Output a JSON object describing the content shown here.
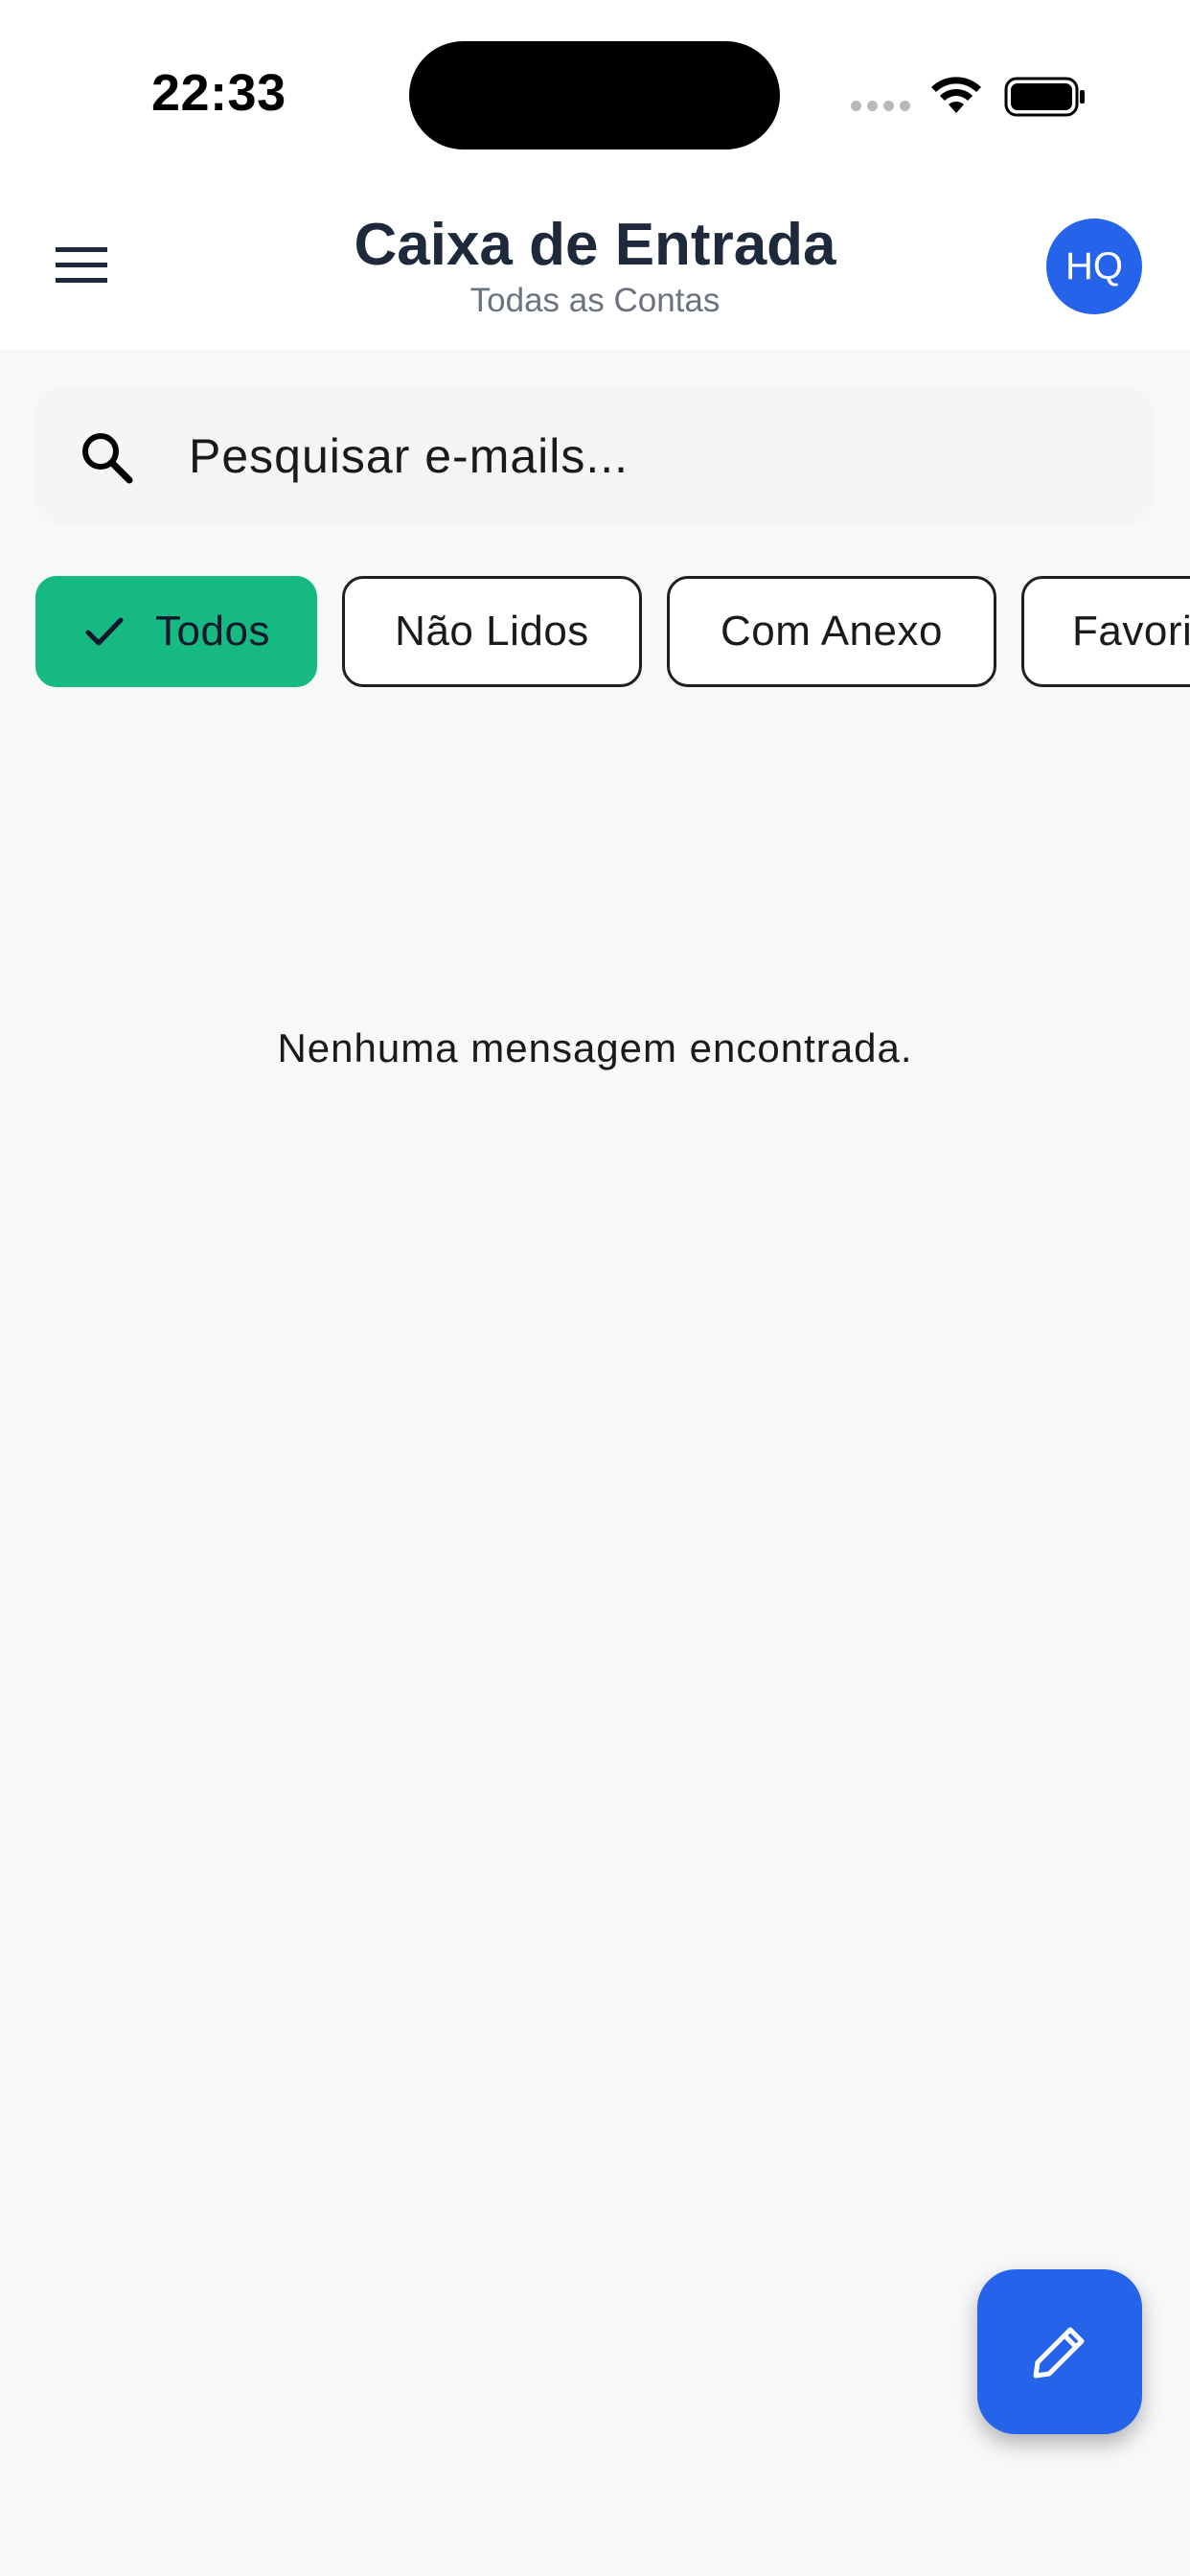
{
  "status_bar": {
    "time": "22:33",
    "icons": [
      "signal-dots-icon",
      "wifi-icon",
      "battery-icon"
    ]
  },
  "header": {
    "title": "Caixa de Entrada",
    "subtitle": "Todas as Contas",
    "avatar_initials": "HQ",
    "menu_icon": "hamburger-menu-icon"
  },
  "search": {
    "placeholder": "Pesquisar e-mails...",
    "value": "",
    "icon": "search-icon"
  },
  "filters": [
    {
      "label": "Todos",
      "selected": true
    },
    {
      "label": "Não Lidos",
      "selected": false
    },
    {
      "label": "Com Anexo",
      "selected": false
    },
    {
      "label": "Favoritos",
      "selected": false
    }
  ],
  "empty_state": {
    "message": "Nenhuma mensagem encontrada."
  },
  "fab": {
    "icon": "pencil-icon"
  },
  "colors": {
    "primary": "#2563eb",
    "selected_chip": "#16b981",
    "title": "#1e293b",
    "subtitle": "#6b7280",
    "background": "#f7f8fa"
  }
}
